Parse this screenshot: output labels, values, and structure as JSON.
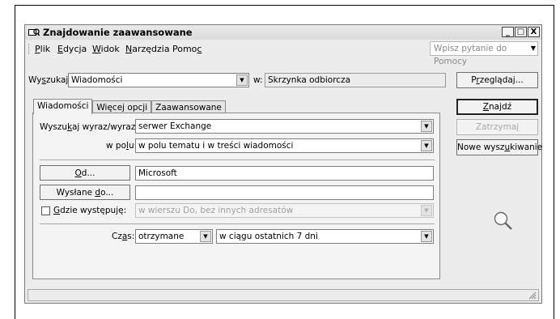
{
  "window": {
    "title": "Znajdowanie zaawansowane",
    "minimize": "_",
    "maximize": "□",
    "close": "X"
  },
  "menu": {
    "items": [
      "Plik",
      "Edycja",
      "Widok",
      "Narzędzia",
      "Pomoc"
    ],
    "help_placeholder": "Wpisz pytanie do Pomocy"
  },
  "search": {
    "label": "Wyszukaj",
    "value": "Wiadomości",
    "in_label": "w:",
    "location": "Skrzynka odbiorcza",
    "browse_button": "Przeglądaj..."
  },
  "tabs": [
    "Wiadomości",
    "Więcej opcji",
    "Zaawansowane"
  ],
  "form": {
    "words_label": "Wyszukaj wyraz/wyrazy:",
    "words_value": "serwer Exchange",
    "in_field_label": "w polu:",
    "in_field_value": "w polu tematu i w treści wiadomości",
    "from_button": "Od...",
    "from_value": "Microsoft",
    "sent_to_button": "Wysłane do...",
    "sent_to_value": "",
    "where_label": "Gdzie występuję:",
    "where_value": "w wierszu Do, bez innych adresatów",
    "time_label": "Czas:",
    "time_type": "otrzymane",
    "time_range": "w ciągu ostatnich 7 dni"
  },
  "actions": {
    "find": "Znajdź",
    "stop": "Zatrzymaj",
    "new_search": "Nowe wyszukiwanie"
  }
}
